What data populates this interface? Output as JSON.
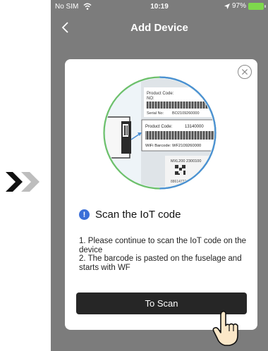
{
  "status": {
    "carrier": "No SIM",
    "time": "10:19",
    "battery": "97%"
  },
  "nav": {
    "title": "Add Device"
  },
  "illustration": {
    "product_code_label": "Product Code:",
    "product_code_value": "13140000",
    "no_label": "NO:",
    "serial_label": "Serial No:",
    "serial_value": "BO2109260000",
    "wifi_barcode": "WiFi Barcode: WF2109260000",
    "model": "MXL200 2300100",
    "model_number": "88614722052"
  },
  "dialog": {
    "title": "Scan the IoT code",
    "instruction_1": "1. Please continue to scan the IoT code on the device",
    "instruction_2": "2. The barcode is pasted on the fuselage and starts with WF",
    "button": "To Scan"
  },
  "colors": {
    "accent": "#3b6fd8",
    "button": "#262626",
    "battery": "#7ed84c",
    "overlay": "#7c7c7c"
  }
}
